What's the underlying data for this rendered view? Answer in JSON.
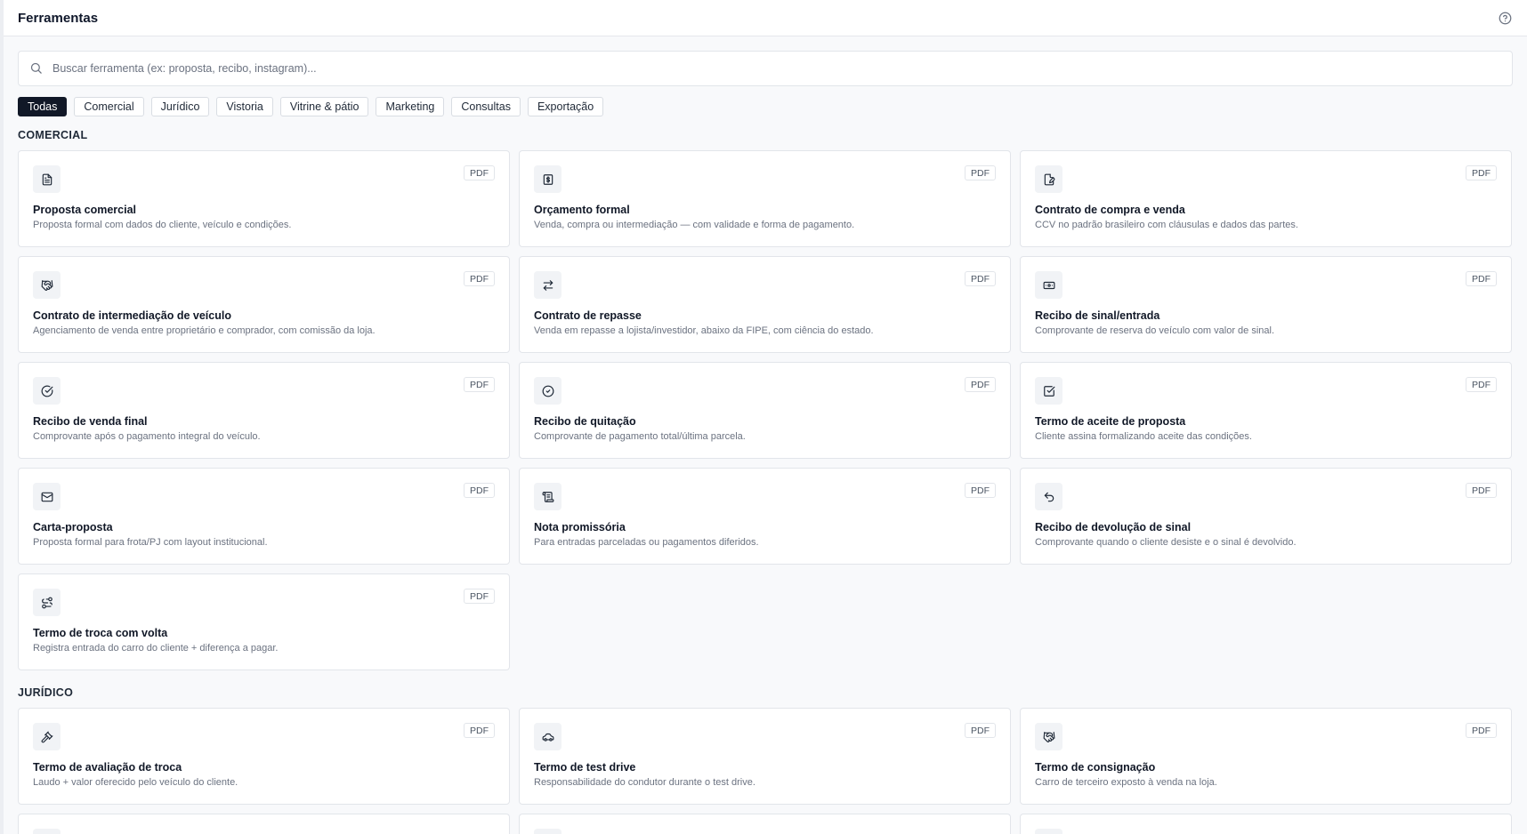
{
  "header": {
    "title": "Ferramentas",
    "help_icon": "help-circle-icon"
  },
  "search": {
    "placeholder": "Buscar ferramenta (ex: proposta, recibo, instagram)...",
    "value": "",
    "icon": "search-icon"
  },
  "filters": [
    "Todas",
    "Comercial",
    "Jurídico",
    "Vistoria",
    "Vitrine & pátio",
    "Marketing",
    "Consultas",
    "Exportação"
  ],
  "active_filter": "Todas",
  "colors": {
    "accent": "#111827",
    "card_border": "#e2e5ea",
    "muted_text": "#6b7280",
    "background": "#f8f9fb"
  },
  "sections": [
    {
      "title": "COMERCIAL",
      "items": [
        {
          "title": "Proposta comercial",
          "desc": "Proposta formal com dados do cliente, veículo e condições.",
          "badge": "PDF",
          "icon": "document-icon"
        },
        {
          "title": "Orçamento formal",
          "desc": "Venda, compra ou intermediação — com validade e forma de pagamento.",
          "badge": "PDF",
          "icon": "dollar-receipt-icon"
        },
        {
          "title": "Contrato de compra e venda",
          "desc": "CCV no padrão brasileiro com cláusulas e dados das partes.",
          "badge": "PDF",
          "icon": "file-signature-icon"
        },
        {
          "title": "Contrato de intermediação de veículo",
          "desc": "Agenciamento de venda entre proprietário e comprador, com comissão da loja.",
          "badge": "PDF",
          "icon": "handshake-icon"
        },
        {
          "title": "Contrato de repasse",
          "desc": "Venda em repasse a lojista/investidor, abaixo da FIPE, com ciência do estado.",
          "badge": "PDF",
          "icon": "arrows-exchange-icon"
        },
        {
          "title": "Recibo de sinal/entrada",
          "desc": "Comprovante de reserva do veículo com valor de sinal.",
          "badge": "PDF",
          "icon": "banknote-icon"
        },
        {
          "title": "Recibo de venda final",
          "desc": "Comprovante após o pagamento integral do veículo.",
          "badge": "PDF",
          "icon": "circle-check-icon"
        },
        {
          "title": "Recibo de quitação",
          "desc": "Comprovante de pagamento total/última parcela.",
          "badge": "PDF",
          "icon": "check-circle-icon"
        },
        {
          "title": "Termo de aceite de proposta",
          "desc": "Cliente assina formalizando aceite das condições.",
          "badge": "PDF",
          "icon": "square-check-icon"
        },
        {
          "title": "Carta-proposta",
          "desc": "Proposta formal para frota/PJ com layout institucional.",
          "badge": "PDF",
          "icon": "mail-icon"
        },
        {
          "title": "Nota promissória",
          "desc": "Para entradas parceladas ou pagamentos diferidos.",
          "badge": "PDF",
          "icon": "scroll-icon"
        },
        {
          "title": "Recibo de devolução de sinal",
          "desc": "Comprovante quando o cliente desiste e o sinal é devolvido.",
          "badge": "PDF",
          "icon": "undo-icon"
        },
        {
          "title": "Termo de troca com volta",
          "desc": "Registra entrada do carro do cliente + diferença a pagar.",
          "badge": "PDF",
          "icon": "swap-dashed-icon"
        }
      ]
    },
    {
      "title": "JURÍDICO",
      "items": [
        {
          "title": "Termo de avaliação de troca",
          "desc": "Laudo + valor oferecido pelo veículo do cliente.",
          "badge": "PDF",
          "icon": "gavel-icon"
        },
        {
          "title": "Termo de test drive",
          "desc": "Responsabilidade do condutor durante o test drive.",
          "badge": "PDF",
          "icon": "car-icon"
        },
        {
          "title": "Termo de consignação",
          "desc": "Carro de terceiro exposto à venda na loja.",
          "badge": "PDF",
          "icon": "handshake-icon"
        }
      ]
    }
  ]
}
